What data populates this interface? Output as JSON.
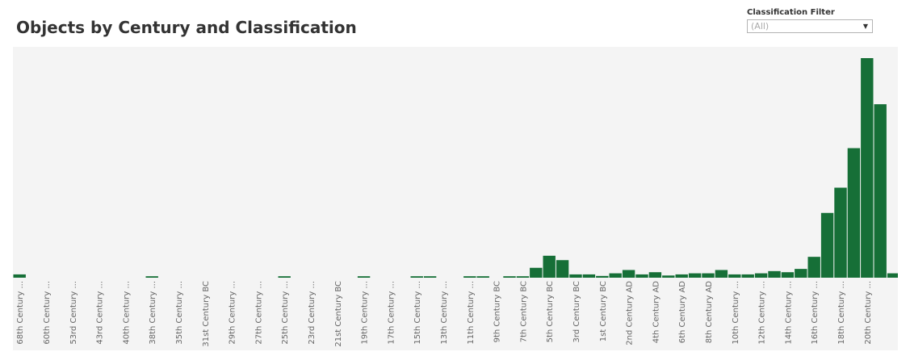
{
  "header": {
    "title": "Objects by Century and Classification"
  },
  "filter": {
    "label": "Classification Filter",
    "selected": "(All)",
    "arrow_icon": "dropdown-triangle-icon"
  },
  "colors": {
    "bar": "#166f37",
    "plot_background": "#f4f4f4",
    "axis_text": "#666666"
  },
  "chart_data": {
    "type": "bar",
    "title": "Objects by Century and Classification",
    "xlabel": "",
    "ylabel": "",
    "grid": false,
    "ylim": [
      0,
      100
    ],
    "categories": [
      "68th Century ...",
      "",
      "60th Century ...",
      "",
      "53rd Century ...",
      "",
      "43rd Century ...",
      "",
      "40th Century ...",
      "",
      "38th Century ...",
      "",
      "35th Century ...",
      "",
      "31st Century BC",
      "",
      "29th Century ...",
      "",
      "27th Century ...",
      "",
      "25th Century ...",
      "",
      "23rd Century ...",
      "",
      "21st Century BC",
      "",
      "19th Century ...",
      "",
      "17th Century ...",
      "",
      "15th Century ...",
      "",
      "13th Century ...",
      "",
      "11th Century ...",
      "",
      "9th Century BC",
      "",
      "7th Century BC",
      "",
      "5th Century BC",
      "",
      "3rd Century BC",
      "",
      "1st Century BC",
      "",
      "2nd Century AD",
      "",
      "4th Century AD",
      "",
      "6th Century AD",
      "",
      "8th Century AD",
      "",
      "10th Century ...",
      "",
      "12th Century ...",
      "",
      "14th Century ...",
      "",
      "16th Century ...",
      "",
      "18th Century ...",
      "",
      "20th Century ...",
      ""
    ],
    "values": [
      1.5,
      0,
      0,
      0,
      0,
      0,
      0,
      0,
      0,
      0,
      0.4,
      0,
      0,
      0,
      0,
      0,
      0,
      0,
      0,
      0,
      0.4,
      0,
      0,
      0,
      0,
      0,
      0.4,
      0,
      0,
      0,
      0.3,
      0.3,
      0,
      0,
      0.3,
      0.3,
      0,
      0.3,
      0.6,
      4.5,
      10,
      8,
      1.5,
      1.5,
      0.8,
      2,
      3.5,
      1.5,
      2.5,
      1,
      1.5,
      2,
      2,
      3.5,
      1.5,
      1.5,
      2,
      3,
      2.5,
      4,
      9.5,
      29.5,
      41,
      59,
      100,
      79,
      2
    ]
  }
}
